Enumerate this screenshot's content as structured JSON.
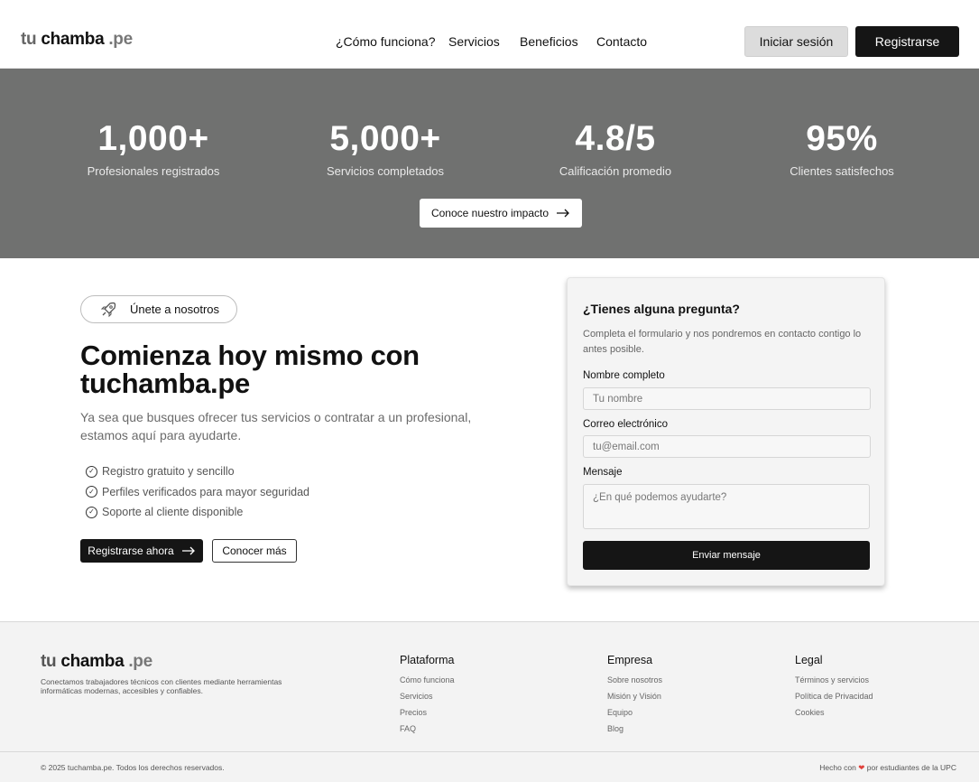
{
  "brand": {
    "tu": "tu",
    "chamba": "chamba",
    "pe": ".pe"
  },
  "nav": {
    "items": [
      "¿Cómo funciona?",
      "Servicios",
      "Beneficios",
      "Contacto"
    ],
    "login": "Iniciar sesión",
    "register": "Registrarse"
  },
  "stats": {
    "items": [
      {
        "value": "1,000+",
        "label": "Profesionales registrados"
      },
      {
        "value": "5,000+",
        "label": "Servicios completados"
      },
      {
        "value": "4.8/5",
        "label": "Calificación promedio"
      },
      {
        "value": "95%",
        "label": "Clientes satisfechos"
      }
    ],
    "impact_button": "Conoce nuestro impacto",
    "background": "#707170"
  },
  "cta": {
    "badge": "Únete a nosotros",
    "title": "Comienza hoy mismo con tuchamba.pe",
    "subtitle": "Ya sea que busques ofrecer tus servicios o contratar a un profesional, estamos aquí para ayudarte.",
    "checks": [
      "Registro gratuito y sencillo",
      "Perfiles verificados para mayor seguridad",
      "Soporte al cliente disponible"
    ],
    "primary_button": "Registrarse ahora",
    "secondary_button": "Conocer más"
  },
  "form": {
    "title": "¿Tienes alguna pregunta?",
    "description": "Completa el formulario y nos pondremos en contacto contigo lo antes posible.",
    "name_label": "Nombre completo",
    "name_placeholder": "Tu nombre",
    "email_label": "Correo electrónico",
    "email_placeholder": "tu@email.com",
    "message_label": "Mensaje",
    "message_placeholder": "¿En qué podemos ayudarte?",
    "submit": "Enviar mensaje"
  },
  "footer": {
    "description": "Conectamos trabajadores técnicos con clientes mediante herramientas informáticas modernas, accesibles y confiables.",
    "columns": [
      {
        "title": "Plataforma",
        "links": [
          "Cómo funciona",
          "Servicios",
          "Precios",
          "FAQ"
        ]
      },
      {
        "title": "Empresa",
        "links": [
          "Sobre nosotros",
          "Misión y Visión",
          "Equipo",
          "Blog"
        ]
      },
      {
        "title": "Legal",
        "links": [
          "Términos y servicios",
          "Política de Privacidad",
          "Cookies"
        ]
      }
    ],
    "copyright": "© 2025 tuchamba.pe. Todos los derechos reservados.",
    "made_prefix": "Hecho con",
    "made_suffix": "por estudiantes de la UPC"
  },
  "icons": {
    "rocket": "rocket-icon",
    "arrow": "arrow-right-icon",
    "check": "check-circle-icon",
    "heart": "heart-icon"
  }
}
